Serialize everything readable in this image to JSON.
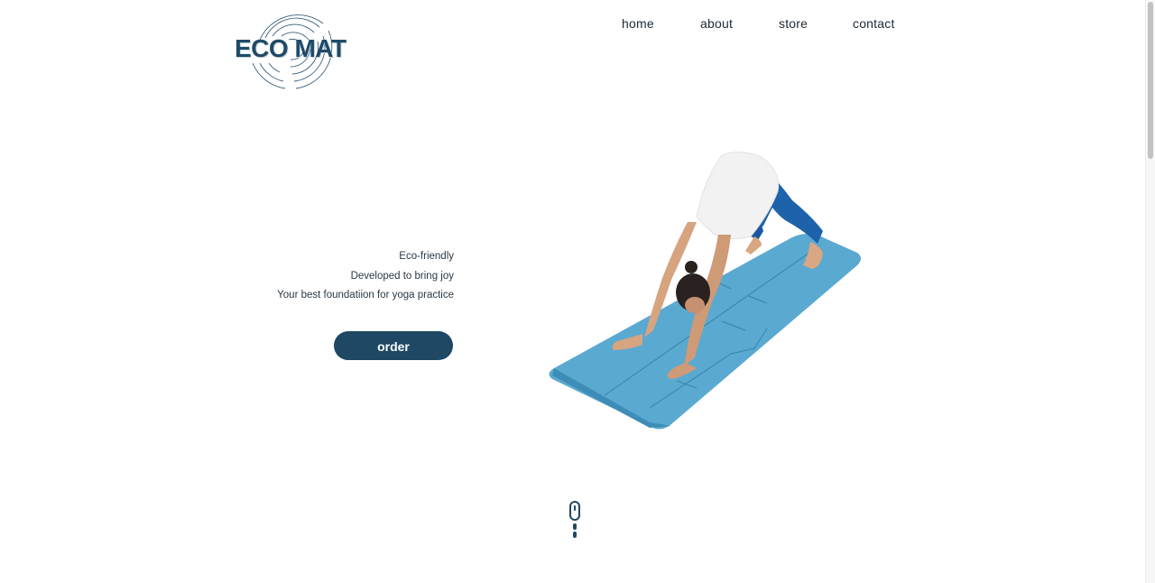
{
  "brand": {
    "logo_text": "ECO MAT",
    "color": "#1f4a68"
  },
  "nav": {
    "items": [
      {
        "label": "home"
      },
      {
        "label": "about"
      },
      {
        "label": "store"
      },
      {
        "label": "contact"
      }
    ]
  },
  "hero": {
    "taglines": [
      "Eco-friendly",
      "Developed to bring joy",
      "Your best foundatiion for yoga practice"
    ],
    "order_label": "order",
    "image_subject": "woman-in-downward-dog-on-blue-yoga-mat",
    "mat_color": "#5aa7cf",
    "button_color": "#1e4864"
  },
  "scroll": {
    "icon": "mouse-scroll-icon"
  }
}
